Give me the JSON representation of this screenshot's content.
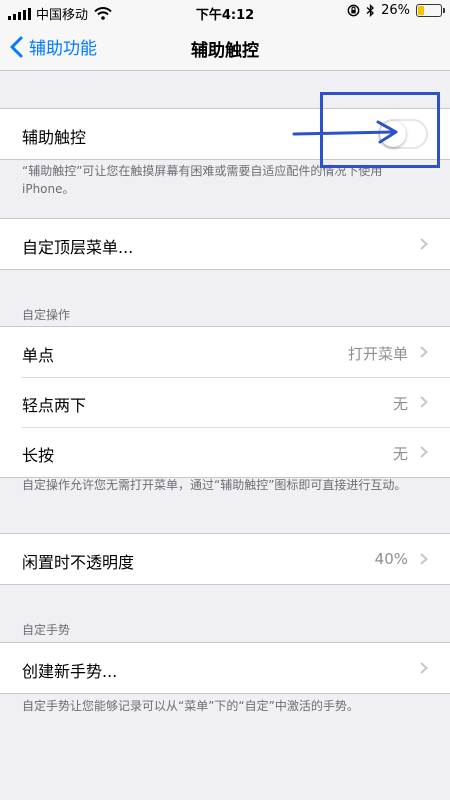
{
  "status": {
    "carrier": "中国移动",
    "time": "下午4:12",
    "battery": "26%",
    "battery_level": 0.26
  },
  "nav": {
    "back_label": "辅助功能",
    "title": "辅助触控"
  },
  "assistive": {
    "label": "辅助触控",
    "toggle_on": false,
    "description": "“辅助触控”可让您在触摸屏幕有困难或需要自适应配件的情况下使用 iPhone。"
  },
  "top_menu": {
    "label": "自定顶层菜单..."
  },
  "custom_actions": {
    "header": "自定操作",
    "items": [
      {
        "label": "单点",
        "value": "打开菜单"
      },
      {
        "label": "轻点两下",
        "value": "无"
      },
      {
        "label": "长按",
        "value": "无"
      }
    ],
    "footer": "自定操作允许您无需打开菜单，通过“辅助触控”图标即可直接进行互动。"
  },
  "idle_opacity": {
    "label": "闲置时不透明度",
    "value": "40%"
  },
  "gestures": {
    "header": "自定手势",
    "create_label": "创建新手势...",
    "footer": "自定手势让您能够记录可以从“菜单”下的“自定”中激活的手势。"
  },
  "colors": {
    "accent": "#007aff",
    "annotation": "#2d52c8",
    "background": "#efeff4"
  }
}
